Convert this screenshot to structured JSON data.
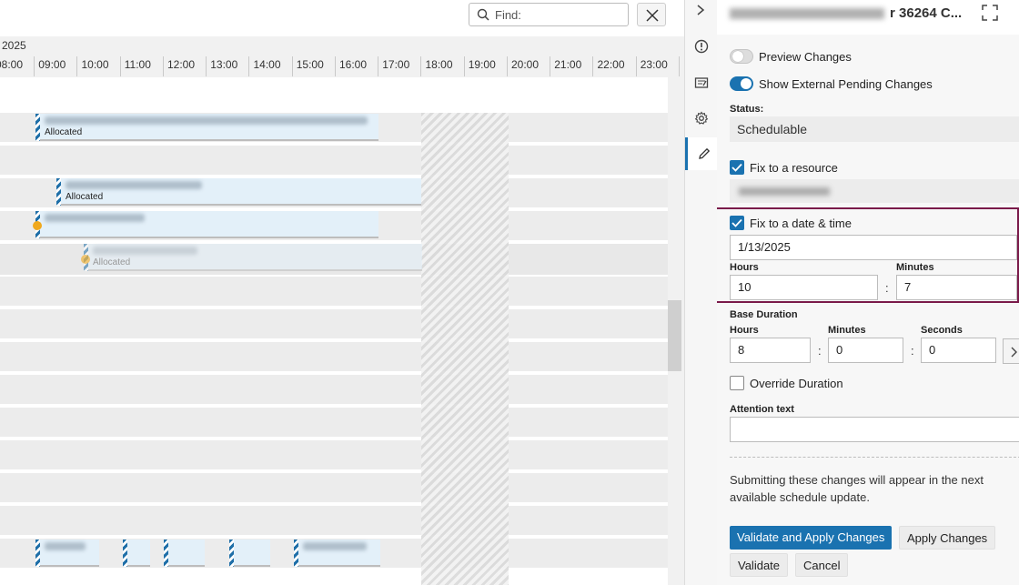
{
  "find": {
    "placeholder": "Find:"
  },
  "timeline": {
    "date_label": "2025",
    "hours": [
      "08:00",
      "09:00",
      "10:00",
      "11:00",
      "12:00",
      "13:00",
      "14:00",
      "15:00",
      "16:00",
      "17:00",
      "18:00",
      "19:00",
      "20:00",
      "21:00",
      "22:00",
      "23:00"
    ]
  },
  "bars": [
    {
      "status": "Allocated"
    },
    {
      "status": "Allocated"
    },
    {
      "status": "Allocated"
    },
    {
      "status": "Allocated"
    }
  ],
  "panel": {
    "title_suffix": "r 36264 C...",
    "preview_changes": "Preview Changes",
    "show_external": "Show External Pending Changes",
    "status_label": "Status:",
    "status_value": "Schedulable",
    "fix_resource": "Fix to a resource",
    "fix_datetime": "Fix to a date & time",
    "date_value": "1/13/2025",
    "hours_label": "Hours",
    "minutes_label": "Minutes",
    "hours_value": "10",
    "minutes_value": "7",
    "base_duration": "Base Duration",
    "bd_hours_label": "Hours",
    "bd_minutes_label": "Minutes",
    "bd_seconds_label": "Seconds",
    "bd_hours": "8",
    "bd_minutes": "0",
    "bd_seconds": "0",
    "override_duration": "Override Duration",
    "attention_text": "Attention text",
    "info": "Submitting these changes will appear in the next available schedule update.",
    "btn_validate_apply": "Validate and Apply Changes",
    "btn_apply": "Apply Changes",
    "btn_validate": "Validate",
    "btn_cancel": "Cancel",
    "colon": ":"
  },
  "colors": {
    "accent": "#1a72b0",
    "highlight_border": "#7a1a4a",
    "marker": "#f0a81d"
  },
  "icons": [
    "search-icon",
    "close-icon",
    "chevron-right-icon",
    "alert-icon",
    "log-icon",
    "gear-icon",
    "pencil-icon",
    "expand-icon",
    "check-icon"
  ]
}
